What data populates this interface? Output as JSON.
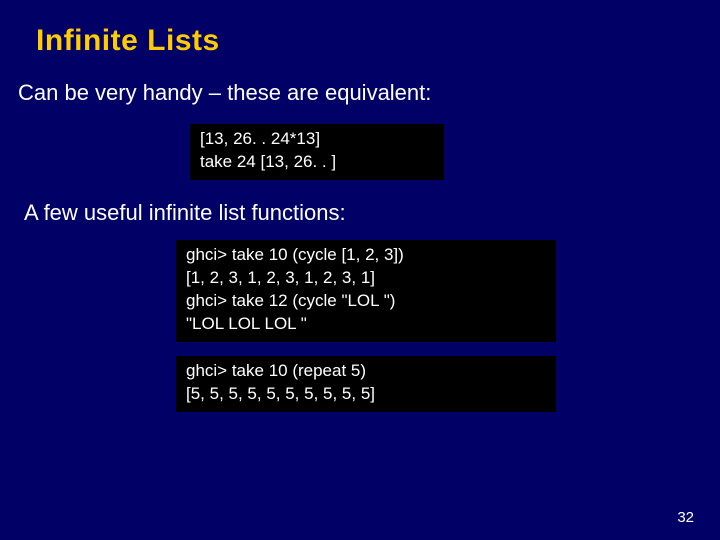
{
  "title": "Infinite Lists",
  "para1": "Can be very handy – these are equivalent:",
  "code1": "[13, 26. . 24*13]\ntake 24 [13, 26. . ]",
  "para2": "A few useful infinite list functions:",
  "code2": "ghci> take 10 (cycle [1, 2, 3])\n[1, 2, 3, 1, 2, 3, 1, 2, 3, 1]\nghci> take 12 (cycle \"LOL \")\n\"LOL LOL LOL \"",
  "code3": "ghci> take 10 (repeat 5)\n[5, 5, 5, 5, 5, 5, 5, 5, 5, 5]",
  "page": "32"
}
